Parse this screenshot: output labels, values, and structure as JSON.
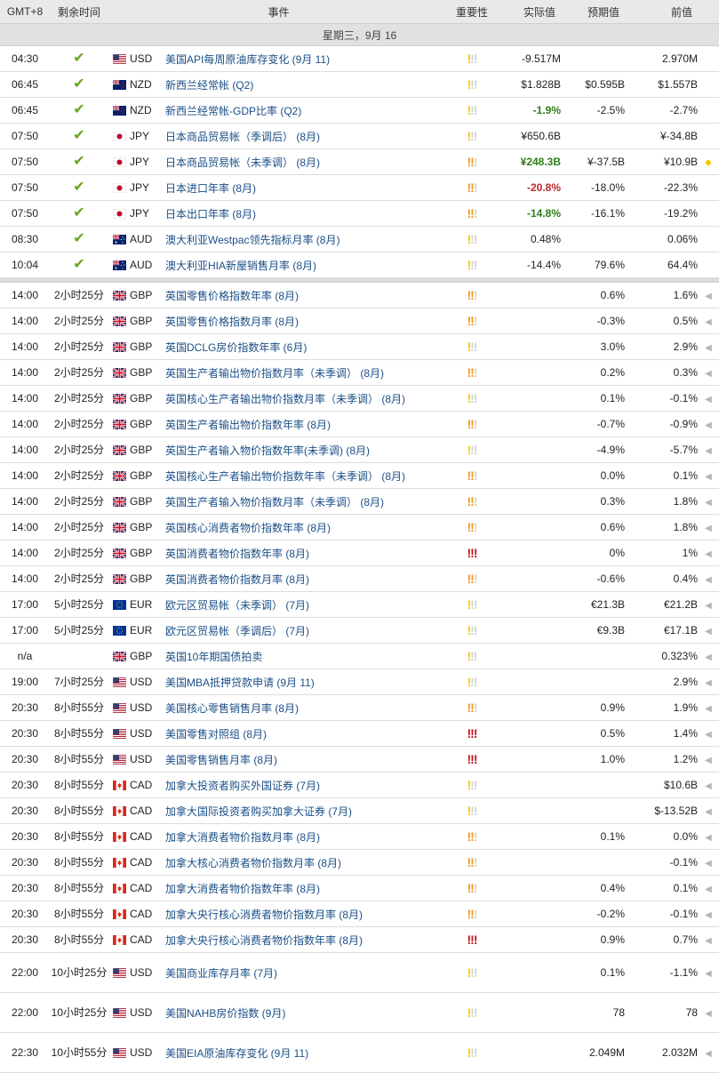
{
  "header": {
    "gmt": "GMT+8",
    "remaining": "剩余时间",
    "event": "事件",
    "importance": "重要性",
    "actual": "实际值",
    "forecast": "预期值",
    "previous": "前值"
  },
  "day_label": "星期三，9月 16",
  "colors": {
    "positive": "#2e7d17",
    "negative": "#c0262b",
    "check": "#6aa51e",
    "imp_low": "#f5c800",
    "imp_med": "#f39a17",
    "imp_high": "#c0141e"
  },
  "rows": [
    {
      "time": "04:30",
      "remaining": "",
      "done": true,
      "flag": "us-flag",
      "cur": "USD",
      "event": "美国API每周原油库存变化 (9月 11)",
      "imp": 1,
      "actual": "-9.517M",
      "actual_style": "",
      "forecast": "",
      "previous": "2.970M",
      "marker": ""
    },
    {
      "time": "06:45",
      "remaining": "",
      "done": true,
      "flag": "nz-flag",
      "cur": "NZD",
      "event": "新西兰经常帐 (Q2)",
      "imp": 1,
      "actual": "$1.828B",
      "actual_style": "",
      "forecast": "$0.595B",
      "previous": "$1.557B",
      "marker": ""
    },
    {
      "time": "06:45",
      "remaining": "",
      "done": true,
      "flag": "nz-flag",
      "cur": "NZD",
      "event": "新西兰经常帐-GDP比率 (Q2)",
      "imp": 1,
      "actual": "-1.9%",
      "actual_style": "pos",
      "forecast": "-2.5%",
      "previous": "-2.7%",
      "marker": ""
    },
    {
      "time": "07:50",
      "remaining": "",
      "done": true,
      "flag": "jp-flag",
      "cur": "JPY",
      "event": "日本商品贸易帐（季调后） (8月)",
      "imp": 1,
      "actual": "¥650.6B",
      "actual_style": "",
      "forecast": "",
      "previous": "¥-34.8B",
      "marker": ""
    },
    {
      "time": "07:50",
      "remaining": "",
      "done": true,
      "flag": "jp-flag",
      "cur": "JPY",
      "event": "日本商品贸易帐（未季调） (8月)",
      "imp": 2,
      "actual": "¥248.3B",
      "actual_style": "pos",
      "forecast": "¥-37.5B",
      "previous": "¥10.9B",
      "marker": "dot"
    },
    {
      "time": "07:50",
      "remaining": "",
      "done": true,
      "flag": "jp-flag",
      "cur": "JPY",
      "event": "日本进口年率 (8月)",
      "imp": 2,
      "actual": "-20.8%",
      "actual_style": "neg",
      "forecast": "-18.0%",
      "previous": "-22.3%",
      "marker": ""
    },
    {
      "time": "07:50",
      "remaining": "",
      "done": true,
      "flag": "jp-flag",
      "cur": "JPY",
      "event": "日本出口年率 (8月)",
      "imp": 2,
      "actual": "-14.8%",
      "actual_style": "pos",
      "forecast": "-16.1%",
      "previous": "-19.2%",
      "marker": ""
    },
    {
      "time": "08:30",
      "remaining": "",
      "done": true,
      "flag": "au-flag",
      "cur": "AUD",
      "event": "澳大利亚Westpac领先指标月率 (8月)",
      "imp": 1,
      "actual": "0.48%",
      "actual_style": "",
      "forecast": "",
      "previous": "0.06%",
      "marker": ""
    },
    {
      "time": "10:04",
      "remaining": "",
      "done": true,
      "flag": "au-flag",
      "cur": "AUD",
      "event": "澳大利亚HIA新屋销售月率 (8月)",
      "imp": 1,
      "actual": "-14.4%",
      "actual_style": "",
      "forecast": "79.6%",
      "previous": "64.4%",
      "marker": ""
    },
    {
      "sep": true
    },
    {
      "time": "14:00",
      "remaining": "2小时25分",
      "done": false,
      "flag": "gb-flag",
      "cur": "GBP",
      "event": "英国零售价格指数年率 (8月)",
      "imp": 2,
      "actual": "",
      "actual_style": "",
      "forecast": "0.6%",
      "previous": "1.6%",
      "marker": "tri"
    },
    {
      "time": "14:00",
      "remaining": "2小时25分",
      "done": false,
      "flag": "gb-flag",
      "cur": "GBP",
      "event": "英国零售价格指数月率 (8月)",
      "imp": 2,
      "actual": "",
      "actual_style": "",
      "forecast": "-0.3%",
      "previous": "0.5%",
      "marker": "tri"
    },
    {
      "time": "14:00",
      "remaining": "2小时25分",
      "done": false,
      "flag": "gb-flag",
      "cur": "GBP",
      "event": "英国DCLG房价指数年率 (6月)",
      "imp": 1,
      "actual": "",
      "actual_style": "",
      "forecast": "3.0%",
      "previous": "2.9%",
      "marker": "tri"
    },
    {
      "time": "14:00",
      "remaining": "2小时25分",
      "done": false,
      "flag": "gb-flag",
      "cur": "GBP",
      "event": "英国生产者输出物价指数月率（未季调） (8月)",
      "imp": 2,
      "actual": "",
      "actual_style": "",
      "forecast": "0.2%",
      "previous": "0.3%",
      "marker": "tri"
    },
    {
      "time": "14:00",
      "remaining": "2小时25分",
      "done": false,
      "flag": "gb-flag",
      "cur": "GBP",
      "event": "英国核心生产者输出物价指数月率（未季调） (8月)",
      "imp": 1,
      "actual": "",
      "actual_style": "",
      "forecast": "0.1%",
      "previous": "-0.1%",
      "marker": "tri"
    },
    {
      "time": "14:00",
      "remaining": "2小时25分",
      "done": false,
      "flag": "gb-flag",
      "cur": "GBP",
      "event": "英国生产者输出物价指数年率 (8月)",
      "imp": 2,
      "actual": "",
      "actual_style": "",
      "forecast": "-0.7%",
      "previous": "-0.9%",
      "marker": "tri"
    },
    {
      "time": "14:00",
      "remaining": "2小时25分",
      "done": false,
      "flag": "gb-flag",
      "cur": "GBP",
      "event": "英国生产者输入物价指数年率(未季调) (8月)",
      "imp": 1,
      "actual": "",
      "actual_style": "",
      "forecast": "-4.9%",
      "previous": "-5.7%",
      "marker": "tri"
    },
    {
      "time": "14:00",
      "remaining": "2小时25分",
      "done": false,
      "flag": "gb-flag",
      "cur": "GBP",
      "event": "英国核心生产者输出物价指数年率（未季调） (8月)",
      "imp": 2,
      "actual": "",
      "actual_style": "",
      "forecast": "0.0%",
      "previous": "0.1%",
      "marker": "tri"
    },
    {
      "time": "14:00",
      "remaining": "2小时25分",
      "done": false,
      "flag": "gb-flag",
      "cur": "GBP",
      "event": "英国生产者输入物价指数月率（未季调） (8月)",
      "imp": 2,
      "actual": "",
      "actual_style": "",
      "forecast": "0.3%",
      "previous": "1.8%",
      "marker": "tri"
    },
    {
      "time": "14:00",
      "remaining": "2小时25分",
      "done": false,
      "flag": "gb-flag",
      "cur": "GBP",
      "event": "英国核心消费者物价指数年率 (8月)",
      "imp": 2,
      "actual": "",
      "actual_style": "",
      "forecast": "0.6%",
      "previous": "1.8%",
      "marker": "tri"
    },
    {
      "time": "14:00",
      "remaining": "2小时25分",
      "done": false,
      "flag": "gb-flag",
      "cur": "GBP",
      "event": "英国消费者物价指数年率 (8月)",
      "imp": 3,
      "actual": "",
      "actual_style": "",
      "forecast": "0%",
      "previous": "1%",
      "marker": "tri"
    },
    {
      "time": "14:00",
      "remaining": "2小时25分",
      "done": false,
      "flag": "gb-flag",
      "cur": "GBP",
      "event": "英国消费者物价指数月率 (8月)",
      "imp": 2,
      "actual": "",
      "actual_style": "",
      "forecast": "-0.6%",
      "previous": "0.4%",
      "marker": "tri"
    },
    {
      "time": "17:00",
      "remaining": "5小时25分",
      "done": false,
      "flag": "eu-flag",
      "cur": "EUR",
      "event": "欧元区贸易帐（未季调） (7月)",
      "imp": 1,
      "actual": "",
      "actual_style": "",
      "forecast": "€21.3B",
      "previous": "€21.2B",
      "marker": "tri"
    },
    {
      "time": "17:00",
      "remaining": "5小时25分",
      "done": false,
      "flag": "eu-flag",
      "cur": "EUR",
      "event": "欧元区贸易帐（季调后） (7月)",
      "imp": 1,
      "actual": "",
      "actual_style": "",
      "forecast": "€9.3B",
      "previous": "€17.1B",
      "marker": "tri"
    },
    {
      "time": "n/a",
      "remaining": "",
      "done": false,
      "flag": "gb-flag",
      "cur": "GBP",
      "event": "英国10年期国债拍卖",
      "imp": 1,
      "actual": "",
      "actual_style": "",
      "forecast": "",
      "previous": "0.323%",
      "marker": "tri"
    },
    {
      "time": "19:00",
      "remaining": "7小时25分",
      "done": false,
      "flag": "us-flag",
      "cur": "USD",
      "event": "美国MBA抵押贷款申请 (9月 11)",
      "imp": 1,
      "actual": "",
      "actual_style": "",
      "forecast": "",
      "previous": "2.9%",
      "marker": "tri"
    },
    {
      "time": "20:30",
      "remaining": "8小时55分",
      "done": false,
      "flag": "us-flag",
      "cur": "USD",
      "event": "美国核心零售销售月率 (8月)",
      "imp": 2,
      "actual": "",
      "actual_style": "",
      "forecast": "0.9%",
      "previous": "1.9%",
      "marker": "tri"
    },
    {
      "time": "20:30",
      "remaining": "8小时55分",
      "done": false,
      "flag": "us-flag",
      "cur": "USD",
      "event": "美国零售对照组 (8月)",
      "imp": 3,
      "actual": "",
      "actual_style": "",
      "forecast": "0.5%",
      "previous": "1.4%",
      "marker": "tri"
    },
    {
      "time": "20:30",
      "remaining": "8小时55分",
      "done": false,
      "flag": "us-flag",
      "cur": "USD",
      "event": "美国零售销售月率 (8月)",
      "imp": 3,
      "actual": "",
      "actual_style": "",
      "forecast": "1.0%",
      "previous": "1.2%",
      "marker": "tri"
    },
    {
      "time": "20:30",
      "remaining": "8小时55分",
      "done": false,
      "flag": "ca-flag",
      "cur": "CAD",
      "event": "加拿大投资者购买外国证券 (7月)",
      "imp": 1,
      "actual": "",
      "actual_style": "",
      "forecast": "",
      "previous": "$10.6B",
      "marker": "tri"
    },
    {
      "time": "20:30",
      "remaining": "8小时55分",
      "done": false,
      "flag": "ca-flag",
      "cur": "CAD",
      "event": "加拿大国际投资者购买加拿大证券 (7月)",
      "imp": 1,
      "actual": "",
      "actual_style": "",
      "forecast": "",
      "previous": "$-13.52B",
      "marker": "tri"
    },
    {
      "time": "20:30",
      "remaining": "8小时55分",
      "done": false,
      "flag": "ca-flag",
      "cur": "CAD",
      "event": "加拿大消费者物价指数月率 (8月)",
      "imp": 2,
      "actual": "",
      "actual_style": "",
      "forecast": "0.1%",
      "previous": "0.0%",
      "marker": "tri"
    },
    {
      "time": "20:30",
      "remaining": "8小时55分",
      "done": false,
      "flag": "ca-flag",
      "cur": "CAD",
      "event": "加拿大核心消费者物价指数月率 (8月)",
      "imp": 2,
      "actual": "",
      "actual_style": "",
      "forecast": "",
      "previous": "-0.1%",
      "marker": "tri"
    },
    {
      "time": "20:30",
      "remaining": "8小时55分",
      "done": false,
      "flag": "ca-flag",
      "cur": "CAD",
      "event": "加拿大消费者物价指数年率 (8月)",
      "imp": 2,
      "actual": "",
      "actual_style": "",
      "forecast": "0.4%",
      "previous": "0.1%",
      "marker": "tri"
    },
    {
      "time": "20:30",
      "remaining": "8小时55分",
      "done": false,
      "flag": "ca-flag",
      "cur": "CAD",
      "event": "加拿大央行核心消费者物价指数月率 (8月)",
      "imp": 2,
      "actual": "",
      "actual_style": "",
      "forecast": "-0.2%",
      "previous": "-0.1%",
      "marker": "tri"
    },
    {
      "time": "20:30",
      "remaining": "8小时55分",
      "done": false,
      "flag": "ca-flag",
      "cur": "CAD",
      "event": "加拿大央行核心消费者物价指数年率 (8月)",
      "imp": 3,
      "actual": "",
      "actual_style": "",
      "forecast": "0.9%",
      "previous": "0.7%",
      "marker": "tri"
    },
    {
      "time": "22:00",
      "remaining": "10小时25分",
      "done": false,
      "tall": true,
      "flag": "us-flag",
      "cur": "USD",
      "event": "美国商业库存月率 (7月)",
      "imp": 1,
      "actual": "",
      "actual_style": "",
      "forecast": "0.1%",
      "previous": "-1.1%",
      "marker": "tri"
    },
    {
      "time": "22:00",
      "remaining": "10小时25分",
      "done": false,
      "tall": true,
      "flag": "us-flag",
      "cur": "USD",
      "event": "美国NAHB房价指数 (9月)",
      "imp": 1,
      "actual": "",
      "actual_style": "",
      "forecast": "78",
      "previous": "78",
      "marker": "tri"
    },
    {
      "time": "22:30",
      "remaining": "10小时55分",
      "done": false,
      "tall": true,
      "flag": "us-flag",
      "cur": "USD",
      "event": "美国EIA原油库存变化 (9月 11)",
      "imp": 1,
      "actual": "",
      "actual_style": "",
      "forecast": "2.049M",
      "previous": "2.032M",
      "marker": "tri"
    }
  ]
}
